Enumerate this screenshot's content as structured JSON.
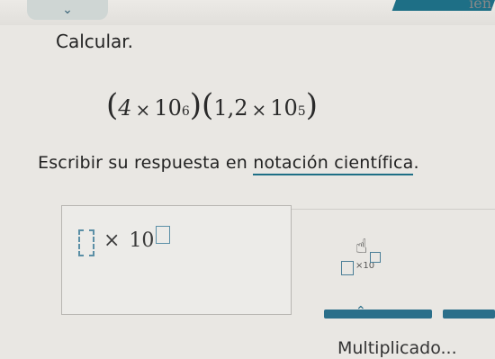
{
  "header": {
    "chevron": "⌄",
    "right_text": "ien"
  },
  "problem": {
    "prompt": "Calcular.",
    "expression": {
      "a_coef": "4",
      "a_base": "10",
      "a_exp": "6",
      "b_coef": "1,2",
      "b_base": "10",
      "b_exp": "5",
      "times": "×"
    },
    "instruction_prefix": "Escribir su respuesta en ",
    "instruction_link": "notación científica",
    "instruction_suffix": "."
  },
  "answer": {
    "times": "×",
    "base": "10"
  },
  "toolbar": {
    "sci_button_label": "×10"
  },
  "bottom": {
    "label": "Multiplicado..."
  },
  "colors": {
    "accent": "#1e6f86",
    "background": "#e9e7e3"
  }
}
